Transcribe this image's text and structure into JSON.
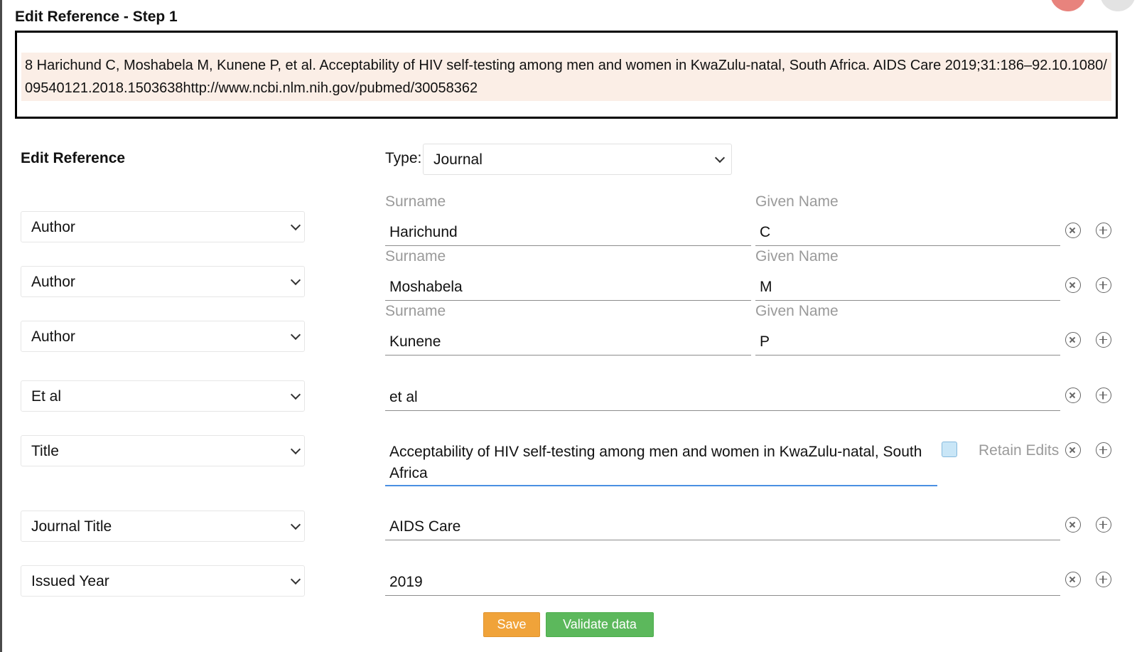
{
  "dialog": {
    "title": "Edit Reference - Step 1",
    "reference_text": "8 Harichund C, Moshabela M, Kunene P, et al. Acceptability of HIV self-testing among men and women in KwaZulu-natal, South Africa. AIDS Care 2019;31:186–92.10.1080/09540121.2018.1503638http://www.ncbi.nlm.nih.gov/pubmed/30058362"
  },
  "editor": {
    "section_title": "Edit Reference",
    "type_label": "Type:",
    "type_value": "Journal",
    "surname_label": "Surname",
    "given_name_label": "Given Name",
    "retain_edits_label": "Retain Edits",
    "retain_edits_checked": false,
    "rows": [
      {
        "field": "Author",
        "surname": "Harichund",
        "given": "C"
      },
      {
        "field": "Author",
        "surname": "Moshabela",
        "given": "M"
      },
      {
        "field": "Author",
        "surname": "Kunene",
        "given": "P"
      },
      {
        "field": "Et al",
        "value": "et al"
      },
      {
        "field": "Title",
        "value": "Acceptability of HIV self-testing among men and women in KwaZulu-natal, South Africa"
      },
      {
        "field": "Journal Title",
        "value": "AIDS Care"
      },
      {
        "field": "Issued Year",
        "value": "2019"
      }
    ]
  },
  "actions": {
    "save_label": "Save",
    "validate_label": "Validate data"
  },
  "icons": {
    "remove": "remove-circle-icon",
    "add": "add-circle-icon",
    "dropdown": "chevron-down-icon"
  },
  "colors": {
    "save": "#f0a33a",
    "validate": "#5cb85c",
    "reference_highlight": "#fbeee6",
    "focus_underline": "#4a90e2",
    "checkbox": "#c9e6f7"
  }
}
